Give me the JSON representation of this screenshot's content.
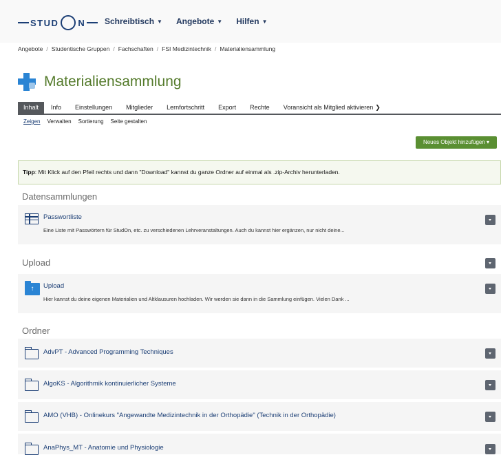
{
  "header": {
    "logo_text_left": "STUD",
    "logo_text_right": "N",
    "nav": [
      {
        "label": "Schreibtisch"
      },
      {
        "label": "Angebote"
      },
      {
        "label": "Hilfen"
      }
    ]
  },
  "breadcrumb": [
    "Angebote",
    "Studentische Gruppen",
    "Fachschaften",
    "FSI Medizintechnik",
    "Materialiensammlung"
  ],
  "page": {
    "title": "Materialiensammlung"
  },
  "tabs": [
    {
      "label": "Inhalt"
    },
    {
      "label": "Info"
    },
    {
      "label": "Einstellungen"
    },
    {
      "label": "Mitglieder"
    },
    {
      "label": "Lernfortschritt"
    },
    {
      "label": "Export"
    },
    {
      "label": "Rechte"
    },
    {
      "label": "Voransicht als Mitglied aktivieren"
    }
  ],
  "subtabs": [
    {
      "label": "Zeigen"
    },
    {
      "label": "Verwalten"
    },
    {
      "label": "Sortierung"
    },
    {
      "label": "Seite gestalten"
    }
  ],
  "add_button": "Neues Objekt hinzufügen ▾",
  "tip": {
    "label": "Tipp",
    "text": ": Mit Klick auf den Pfeil rechts und dann \"Download\" kannst du ganze Ordner auf einmal als .zip-Archiv herunterladen."
  },
  "sections": {
    "datensammlungen": {
      "title": "Datensammlungen",
      "item": {
        "title": "Passwortliste",
        "desc": "Eine Liste mit Passwörtern für StudOn, etc. zu verschiedenen Lehrveranstaltungen. Auch du kannst hier ergänzen, nur nicht deine..."
      }
    },
    "upload": {
      "title": "Upload",
      "item": {
        "title": "Upload",
        "desc": "Hier kannst du deine eigenen Materialien und Altklausuren hochladen. Wir werden sie dann in die Sammlung einfügen. Vielen Dank ..."
      }
    },
    "ordner": {
      "title": "Ordner",
      "items": [
        {
          "title": "AdvPT - Advanced Programming Techniques"
        },
        {
          "title": "AlgoKS - Algorithmik kontinuierlicher Systeme"
        },
        {
          "title": "AMO (VHB) - Onlinekurs \"Angewandte Medizintechnik in der Orthopädie\" (Technik in der Orthopädie)"
        },
        {
          "title": "AnaPhys_MT - Anatomie und Physiologie"
        }
      ]
    }
  },
  "colors": {
    "accent_green": "#557b2c",
    "button_green": "#5a8f32",
    "link_blue": "#1b3e75",
    "icon_blue": "#2a84d4",
    "tab_dark": "#55585c"
  },
  "icons": {
    "title": "category-plus-icon",
    "datasammlung": "table-icon",
    "upload": "upload-folder-icon",
    "ordner": "folder-icon",
    "dropdown": "chevron-down-icon"
  }
}
